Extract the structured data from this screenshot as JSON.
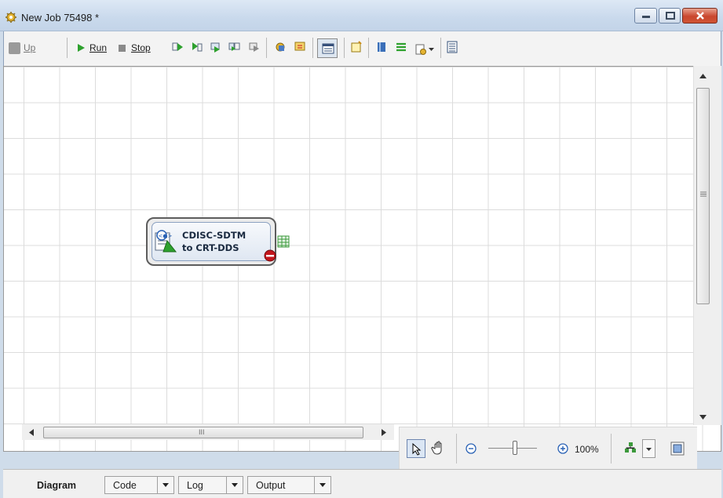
{
  "window": {
    "title": "New Job 75498 *"
  },
  "toolbar": {
    "up_label": "Up",
    "run_label": "Run",
    "stop_label": "Stop"
  },
  "diagram": {
    "node": {
      "label": "CDISC-SDTM\nto CRT-DDS"
    }
  },
  "scrollbar": {
    "grip": "III"
  },
  "zoom": {
    "value": "100%"
  },
  "tabs": [
    {
      "label": "Diagram",
      "active": true
    },
    {
      "label": "Code"
    },
    {
      "label": "Log"
    },
    {
      "label": "Output"
    }
  ],
  "colors": {
    "run_green": "#2ea12e",
    "stop_grey": "#8a8a8a",
    "error_red": "#c4161c",
    "close_red": "#c9472e"
  }
}
